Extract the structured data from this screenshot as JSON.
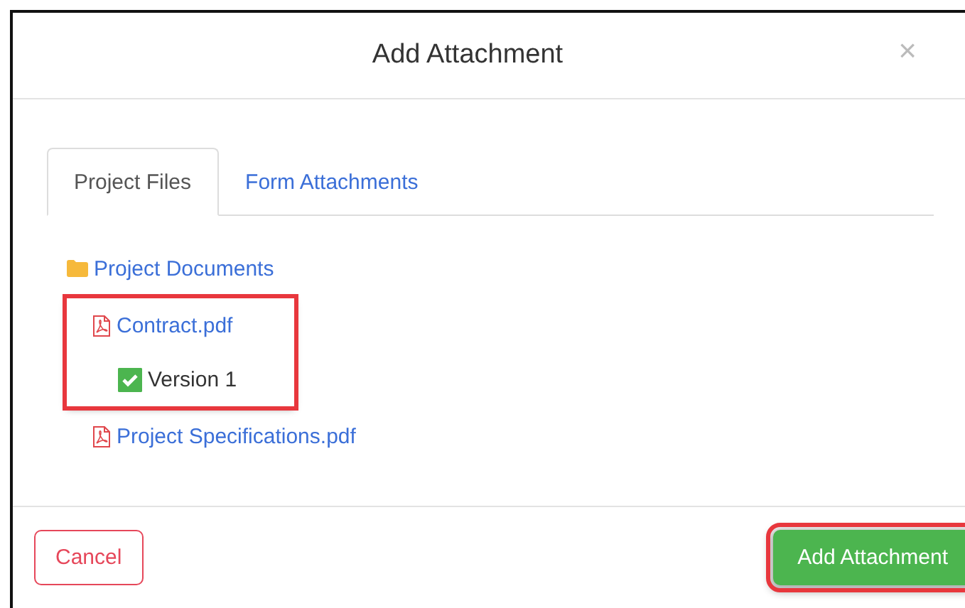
{
  "dialog": {
    "title": "Add Attachment",
    "close": "×"
  },
  "tabs": [
    {
      "label": "Project Files",
      "selected": true
    },
    {
      "label": "Form Attachments",
      "selected": false
    }
  ],
  "tree": [
    {
      "label": "Project Documents",
      "kind": "folder",
      "highlighted": false,
      "children": [
        {
          "label": "Contract.pdf",
          "kind": "pdf",
          "highlighted": true,
          "children": [
            {
              "label": "Version 1",
              "kind": "version",
              "checked": true
            }
          ]
        },
        {
          "label": "Project Specifications.pdf",
          "kind": "pdf",
          "highlighted": false
        }
      ]
    }
  ],
  "buttons": [
    {
      "label": "Cancel",
      "kind": "cancel",
      "highlighted": false
    },
    {
      "label": "Add Attachment",
      "kind": "primary",
      "highlighted": true
    }
  ]
}
